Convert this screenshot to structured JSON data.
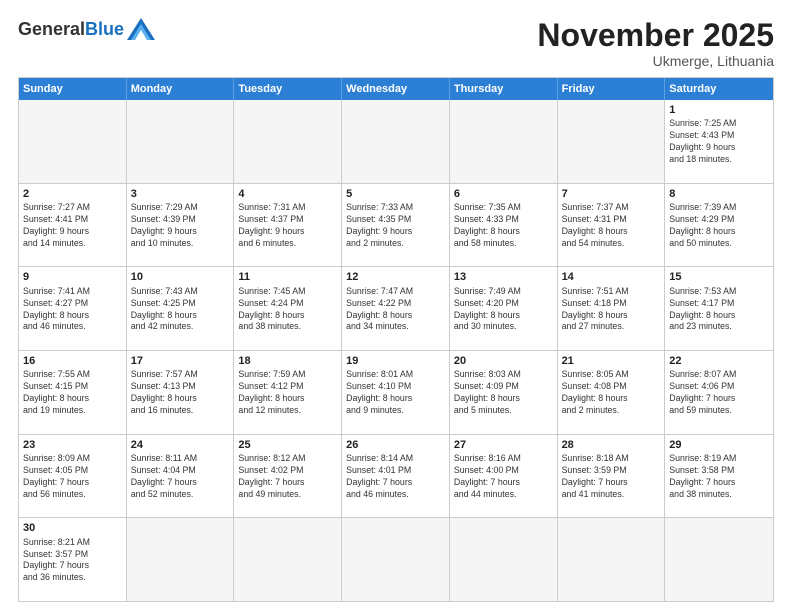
{
  "header": {
    "logo_general": "General",
    "logo_blue": "Blue",
    "month_title": "November 2025",
    "location": "Ukmerge, Lithuania"
  },
  "days_of_week": [
    "Sunday",
    "Monday",
    "Tuesday",
    "Wednesday",
    "Thursday",
    "Friday",
    "Saturday"
  ],
  "weeks": [
    [
      {
        "day": "",
        "empty": true
      },
      {
        "day": "",
        "empty": true
      },
      {
        "day": "",
        "empty": true
      },
      {
        "day": "",
        "empty": true
      },
      {
        "day": "",
        "empty": true
      },
      {
        "day": "",
        "empty": true
      },
      {
        "day": "1",
        "info": "Sunrise: 7:25 AM\nSunset: 4:43 PM\nDaylight: 9 hours\nand 18 minutes."
      }
    ],
    [
      {
        "day": "2",
        "info": "Sunrise: 7:27 AM\nSunset: 4:41 PM\nDaylight: 9 hours\nand 14 minutes."
      },
      {
        "day": "3",
        "info": "Sunrise: 7:29 AM\nSunset: 4:39 PM\nDaylight: 9 hours\nand 10 minutes."
      },
      {
        "day": "4",
        "info": "Sunrise: 7:31 AM\nSunset: 4:37 PM\nDaylight: 9 hours\nand 6 minutes."
      },
      {
        "day": "5",
        "info": "Sunrise: 7:33 AM\nSunset: 4:35 PM\nDaylight: 9 hours\nand 2 minutes."
      },
      {
        "day": "6",
        "info": "Sunrise: 7:35 AM\nSunset: 4:33 PM\nDaylight: 8 hours\nand 58 minutes."
      },
      {
        "day": "7",
        "info": "Sunrise: 7:37 AM\nSunset: 4:31 PM\nDaylight: 8 hours\nand 54 minutes."
      },
      {
        "day": "8",
        "info": "Sunrise: 7:39 AM\nSunset: 4:29 PM\nDaylight: 8 hours\nand 50 minutes."
      }
    ],
    [
      {
        "day": "9",
        "info": "Sunrise: 7:41 AM\nSunset: 4:27 PM\nDaylight: 8 hours\nand 46 minutes."
      },
      {
        "day": "10",
        "info": "Sunrise: 7:43 AM\nSunset: 4:25 PM\nDaylight: 8 hours\nand 42 minutes."
      },
      {
        "day": "11",
        "info": "Sunrise: 7:45 AM\nSunset: 4:24 PM\nDaylight: 8 hours\nand 38 minutes."
      },
      {
        "day": "12",
        "info": "Sunrise: 7:47 AM\nSunset: 4:22 PM\nDaylight: 8 hours\nand 34 minutes."
      },
      {
        "day": "13",
        "info": "Sunrise: 7:49 AM\nSunset: 4:20 PM\nDaylight: 8 hours\nand 30 minutes."
      },
      {
        "day": "14",
        "info": "Sunrise: 7:51 AM\nSunset: 4:18 PM\nDaylight: 8 hours\nand 27 minutes."
      },
      {
        "day": "15",
        "info": "Sunrise: 7:53 AM\nSunset: 4:17 PM\nDaylight: 8 hours\nand 23 minutes."
      }
    ],
    [
      {
        "day": "16",
        "info": "Sunrise: 7:55 AM\nSunset: 4:15 PM\nDaylight: 8 hours\nand 19 minutes."
      },
      {
        "day": "17",
        "info": "Sunrise: 7:57 AM\nSunset: 4:13 PM\nDaylight: 8 hours\nand 16 minutes."
      },
      {
        "day": "18",
        "info": "Sunrise: 7:59 AM\nSunset: 4:12 PM\nDaylight: 8 hours\nand 12 minutes."
      },
      {
        "day": "19",
        "info": "Sunrise: 8:01 AM\nSunset: 4:10 PM\nDaylight: 8 hours\nand 9 minutes."
      },
      {
        "day": "20",
        "info": "Sunrise: 8:03 AM\nSunset: 4:09 PM\nDaylight: 8 hours\nand 5 minutes."
      },
      {
        "day": "21",
        "info": "Sunrise: 8:05 AM\nSunset: 4:08 PM\nDaylight: 8 hours\nand 2 minutes."
      },
      {
        "day": "22",
        "info": "Sunrise: 8:07 AM\nSunset: 4:06 PM\nDaylight: 7 hours\nand 59 minutes."
      }
    ],
    [
      {
        "day": "23",
        "info": "Sunrise: 8:09 AM\nSunset: 4:05 PM\nDaylight: 7 hours\nand 56 minutes."
      },
      {
        "day": "24",
        "info": "Sunrise: 8:11 AM\nSunset: 4:04 PM\nDaylight: 7 hours\nand 52 minutes."
      },
      {
        "day": "25",
        "info": "Sunrise: 8:12 AM\nSunset: 4:02 PM\nDaylight: 7 hours\nand 49 minutes."
      },
      {
        "day": "26",
        "info": "Sunrise: 8:14 AM\nSunset: 4:01 PM\nDaylight: 7 hours\nand 46 minutes."
      },
      {
        "day": "27",
        "info": "Sunrise: 8:16 AM\nSunset: 4:00 PM\nDaylight: 7 hours\nand 44 minutes."
      },
      {
        "day": "28",
        "info": "Sunrise: 8:18 AM\nSunset: 3:59 PM\nDaylight: 7 hours\nand 41 minutes."
      },
      {
        "day": "29",
        "info": "Sunrise: 8:19 AM\nSunset: 3:58 PM\nDaylight: 7 hours\nand 38 minutes."
      }
    ],
    [
      {
        "day": "30",
        "info": "Sunrise: 8:21 AM\nSunset: 3:57 PM\nDaylight: 7 hours\nand 36 minutes."
      },
      {
        "day": "",
        "empty": true
      },
      {
        "day": "",
        "empty": true
      },
      {
        "day": "",
        "empty": true
      },
      {
        "day": "",
        "empty": true
      },
      {
        "day": "",
        "empty": true
      },
      {
        "day": "",
        "empty": true
      }
    ]
  ]
}
